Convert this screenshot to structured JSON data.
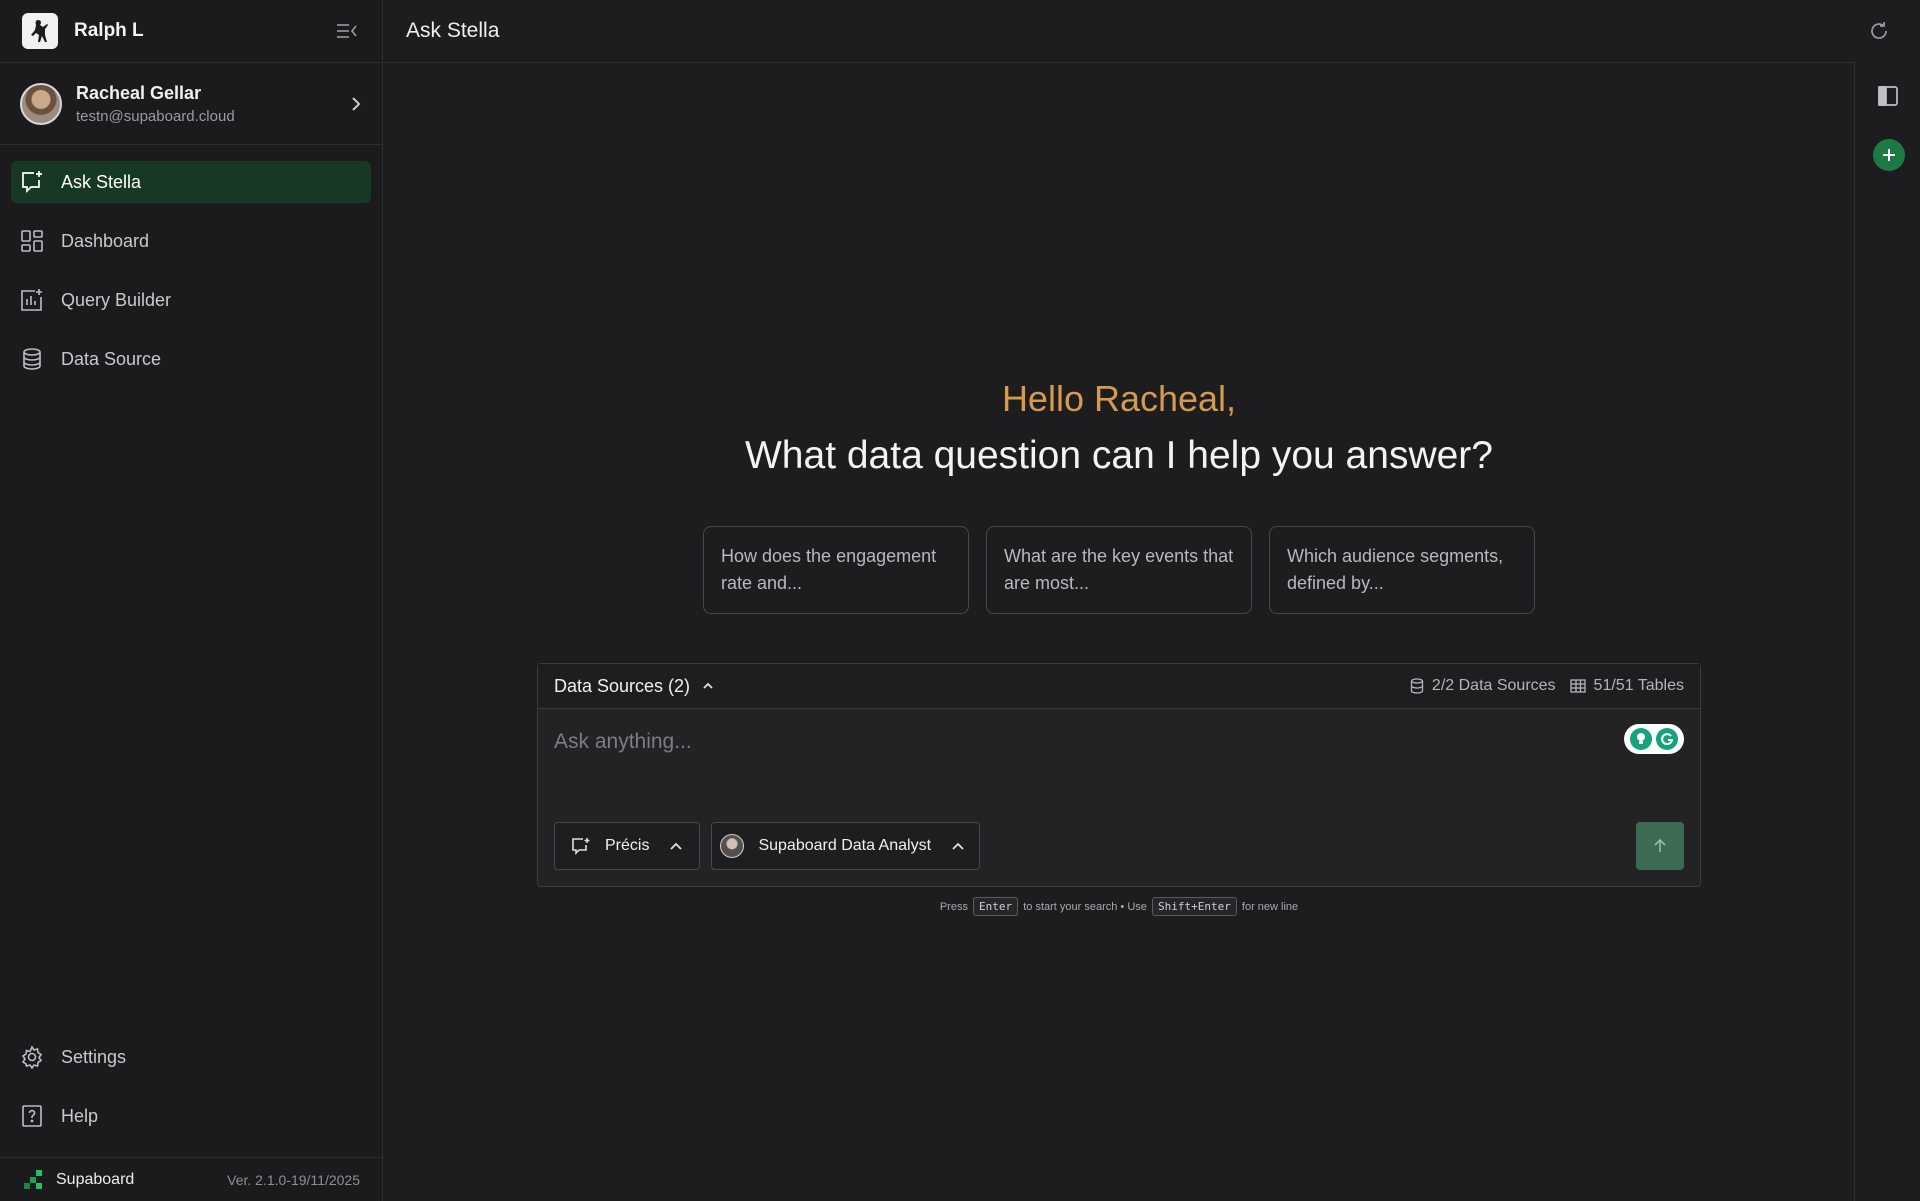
{
  "org": {
    "name": "Ralph L",
    "logo": "polo-player-logo"
  },
  "user": {
    "name": "Racheal Gellar",
    "email": "testn@supaboard.cloud"
  },
  "nav": {
    "items": [
      {
        "label": "Ask Stella",
        "icon": "chat-spark-icon",
        "active": true
      },
      {
        "label": "Dashboard",
        "icon": "grid-icon",
        "active": false
      },
      {
        "label": "Query Builder",
        "icon": "chart-plus-icon",
        "active": false
      },
      {
        "label": "Data Source",
        "icon": "database-icon",
        "active": false
      }
    ],
    "bottom": [
      {
        "label": "Settings",
        "icon": "gear-icon"
      },
      {
        "label": "Help",
        "icon": "help-icon"
      }
    ]
  },
  "footer": {
    "brand": "Supaboard",
    "version": "Ver. 2.1.0-19/11/2025"
  },
  "header": {
    "title": "Ask Stella"
  },
  "greeting": {
    "hello": "Hello Racheal,",
    "question": "What data question can I help you answer?"
  },
  "suggestions": [
    "How does the engagement rate and...",
    "What are the key events that are most...",
    "Which audience segments, defined by..."
  ],
  "composer": {
    "data_sources_label": "Data Sources (2)",
    "sources_stat": "2/2 Data Sources",
    "tables_stat": "51/51 Tables",
    "placeholder": "Ask anything...",
    "mode": "Précis",
    "agent": "Supaboard Data Analyst"
  },
  "hint": {
    "press": "Press",
    "enter": "Enter",
    "mid": "to start your search • Use",
    "shift_enter": "Shift+Enter",
    "end": "for new line"
  },
  "colors": {
    "accent_green": "#173823",
    "send_button": "#3d6a52",
    "greeting_orange": "#d49a4e",
    "new_button": "#1d7a44"
  }
}
